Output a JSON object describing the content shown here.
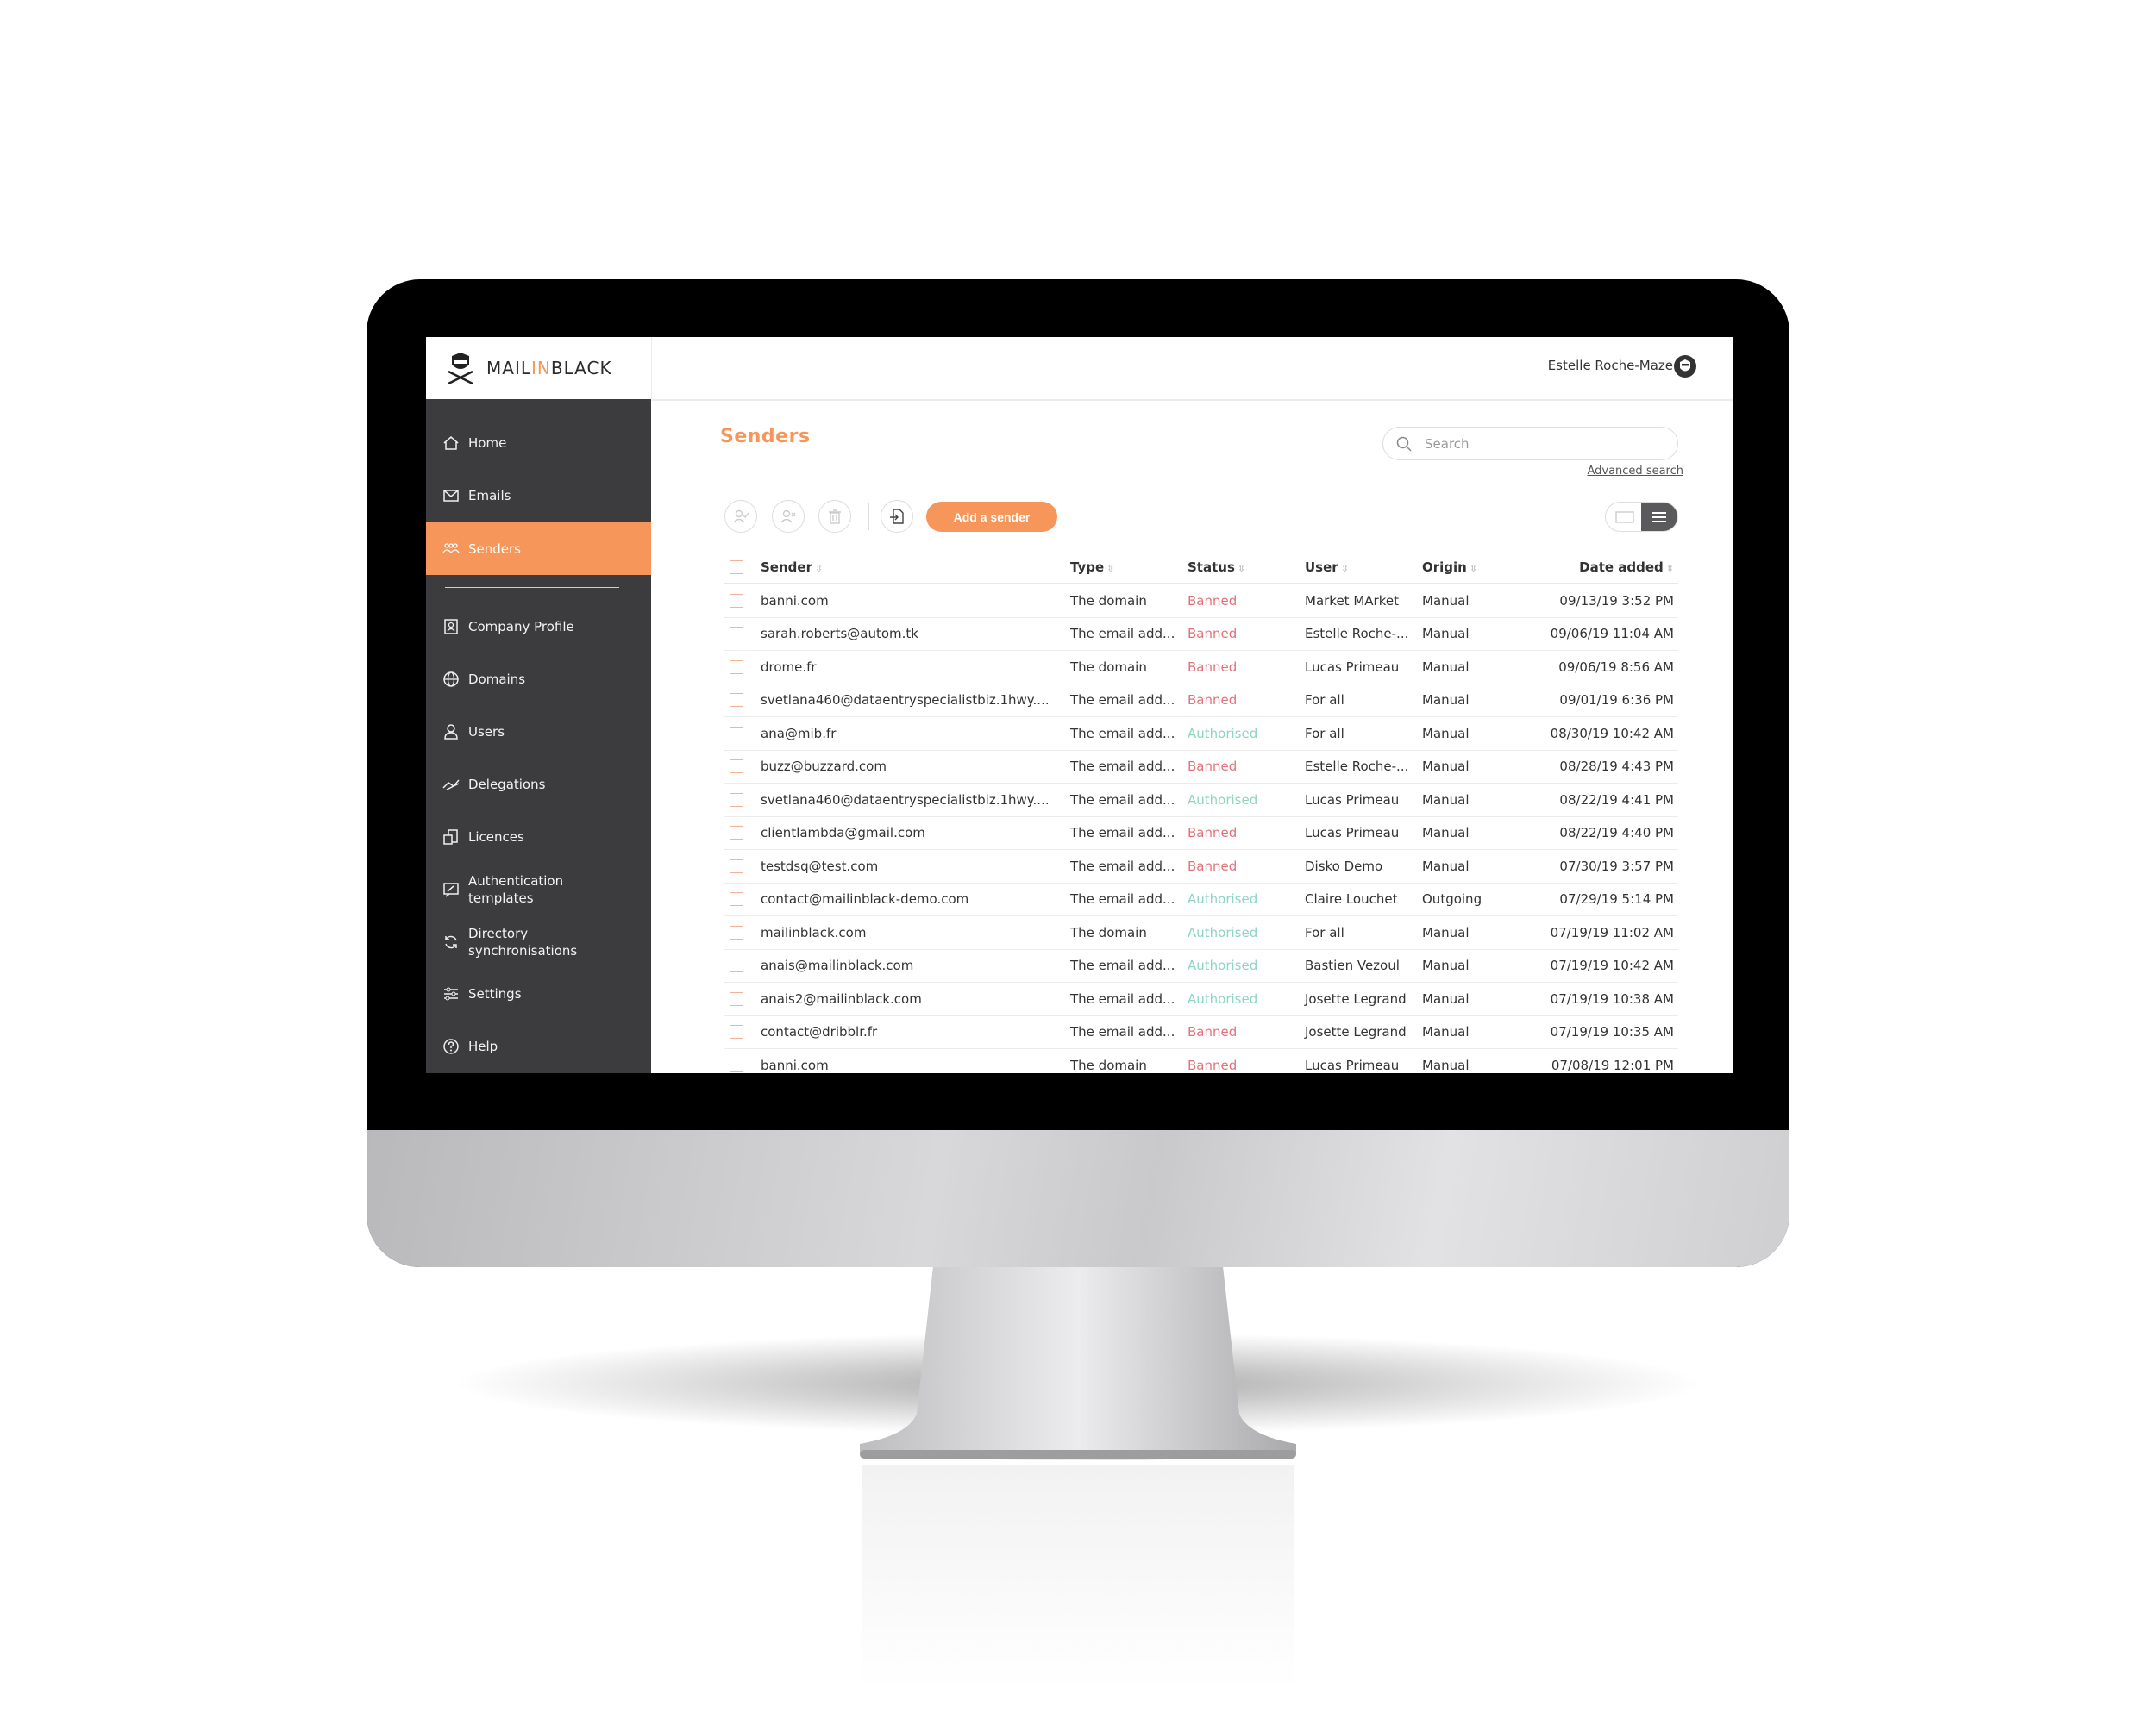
{
  "brand": {
    "logo_prefix": "MAIL",
    "logo_mid": "IN",
    "logo_suffix": "BLACK",
    "accent": "#f7965a"
  },
  "header": {
    "user_name": "Estelle Roche-Maze"
  },
  "sidebar": {
    "items": [
      {
        "label": "Home",
        "icon": "home-icon"
      },
      {
        "label": "Emails",
        "icon": "envelope-icon"
      },
      {
        "label": "Senders",
        "icon": "senders-icon",
        "active": true
      },
      {
        "label": "Company Profile",
        "icon": "company-profile-icon"
      },
      {
        "label": "Domains",
        "icon": "globe-icon"
      },
      {
        "label": "Users",
        "icon": "user-icon"
      },
      {
        "label": "Delegations",
        "icon": "delegations-icon"
      },
      {
        "label": "Licences",
        "icon": "licences-icon"
      },
      {
        "label": "Authentication",
        "label2": "templates",
        "icon": "authentication-templates-icon"
      },
      {
        "label": "Directory",
        "label2": "synchronisations",
        "icon": "sync-icon"
      },
      {
        "label": "Settings",
        "icon": "sliders-icon"
      },
      {
        "label": "Help",
        "icon": "help-icon"
      }
    ]
  },
  "main": {
    "title": "Senders",
    "search": {
      "placeholder": "Search",
      "value": ""
    },
    "advanced_search": "Advanced search",
    "add_sender": "Add a sender",
    "columns": {
      "sender": "Sender",
      "type": "Type",
      "status": "Status",
      "user": "User",
      "origin": "Origin",
      "date": "Date added"
    },
    "status_colors": {
      "Banned": "#e0727c",
      "Authorised": "#8fd4c3"
    },
    "rows": [
      {
        "sender": "banni.com",
        "type": "The domain",
        "status": "Banned",
        "user": "Market MArket",
        "origin": "Manual",
        "date": "09/13/19 3:52 PM"
      },
      {
        "sender": "sarah.roberts@autom.tk",
        "type": "The email add...",
        "status": "Banned",
        "user": "Estelle Roche-...",
        "origin": "Manual",
        "date": "09/06/19 11:04 AM"
      },
      {
        "sender": "drome.fr",
        "type": "The domain",
        "status": "Banned",
        "user": "Lucas Primeau",
        "origin": "Manual",
        "date": "09/06/19 8:56 AM"
      },
      {
        "sender": "svetlana460@dataentryspecialistbiz.1hwy....",
        "type": "The email add...",
        "status": "Banned",
        "user": "For all",
        "origin": "Manual",
        "date": "09/01/19 6:36 PM"
      },
      {
        "sender": "ana@mib.fr",
        "type": "The email add...",
        "status": "Authorised",
        "user": "For all",
        "origin": "Manual",
        "date": "08/30/19 10:42 AM"
      },
      {
        "sender": "buzz@buzzard.com",
        "type": "The email add...",
        "status": "Banned",
        "user": "Estelle Roche-...",
        "origin": "Manual",
        "date": "08/28/19 4:43 PM"
      },
      {
        "sender": "svetlana460@dataentryspecialistbiz.1hwy....",
        "type": "The email add...",
        "status": "Authorised",
        "user": "Lucas Primeau",
        "origin": "Manual",
        "date": "08/22/19 4:41 PM"
      },
      {
        "sender": "clientlambda@gmail.com",
        "type": "The email add...",
        "status": "Banned",
        "user": "Lucas Primeau",
        "origin": "Manual",
        "date": "08/22/19 4:40 PM"
      },
      {
        "sender": "testdsq@test.com",
        "type": "The email add...",
        "status": "Banned",
        "user": "Disko Demo",
        "origin": "Manual",
        "date": "07/30/19 3:57 PM"
      },
      {
        "sender": "contact@mailinblack-demo.com",
        "type": "The email add...",
        "status": "Authorised",
        "user": "Claire Louchet",
        "origin": "Outgoing",
        "date": "07/29/19 5:14 PM"
      },
      {
        "sender": "mailinblack.com",
        "type": "The domain",
        "status": "Authorised",
        "user": "For all",
        "origin": "Manual",
        "date": "07/19/19 11:02 AM"
      },
      {
        "sender": "anais@mailinblack.com",
        "type": "The email add...",
        "status": "Authorised",
        "user": "Bastien Vezoul",
        "origin": "Manual",
        "date": "07/19/19 10:42 AM"
      },
      {
        "sender": "anais2@mailinblack.com",
        "type": "The email add...",
        "status": "Authorised",
        "user": "Josette Legrand",
        "origin": "Manual",
        "date": "07/19/19 10:38 AM"
      },
      {
        "sender": "contact@dribblr.fr",
        "type": "The email add...",
        "status": "Banned",
        "user": "Josette Legrand",
        "origin": "Manual",
        "date": "07/19/19 10:35 AM"
      },
      {
        "sender": "banni.com",
        "type": "The domain",
        "status": "Banned",
        "user": "Lucas Primeau",
        "origin": "Manual",
        "date": "07/08/19 12:01 PM"
      }
    ]
  }
}
